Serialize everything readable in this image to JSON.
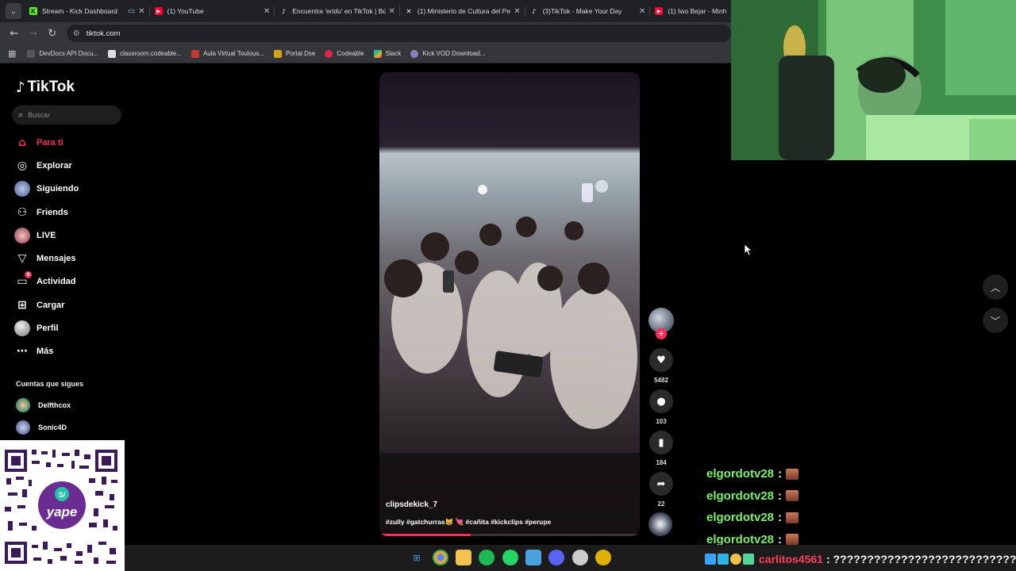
{
  "browser": {
    "tabs": [
      {
        "label": "Stream - Kick Dashboard",
        "icon": "kick-icon",
        "color": "#53fc18"
      },
      {
        "label": "(1) YouTube",
        "icon": "youtube-icon",
        "color": "#ff0033"
      },
      {
        "label": "Encuentra 'eridu' en TikTok | Bú",
        "icon": "tiktok-icon",
        "color": "#ffffff"
      },
      {
        "label": "(1) Ministerio de Cultura del Pe",
        "icon": "x-icon",
        "color": "#ffffff"
      },
      {
        "label": "(3)TikTok - Make Your Day",
        "icon": "tiktok-icon",
        "color": "#ffffff"
      },
      {
        "label": "(1) Iwo Bejar - Minha E",
        "icon": "youtube-icon",
        "color": "#ff0033"
      }
    ],
    "url": "tiktok.com",
    "bookmarks": [
      {
        "label": "DevDocs API Docu...",
        "color": "#555555"
      },
      {
        "label": "classroom.codeable...",
        "color": "#dddddd"
      },
      {
        "label": "Aula Virtual Toulous...",
        "color": "#c0392b"
      },
      {
        "label": "Portal Dse",
        "color": "#d4a017"
      },
      {
        "label": "Codeable",
        "color": "#e0264b"
      },
      {
        "label": "Slack",
        "color": "#e01e5a"
      },
      {
        "label": "Kick VOD Download...",
        "color": "#8e7cc3"
      }
    ]
  },
  "tiktok": {
    "logo": "TikTok",
    "search_placeholder": "Buscar",
    "nav": [
      {
        "label": "Para ti",
        "icon": "home-icon",
        "active": true
      },
      {
        "label": "Explorar",
        "icon": "compass-icon"
      },
      {
        "label": "Siguiendo",
        "icon": "following-avatar-icon"
      },
      {
        "label": "Friends",
        "icon": "friends-icon"
      },
      {
        "label": "LIVE",
        "icon": "live-icon"
      },
      {
        "label": "Mensajes",
        "icon": "messages-icon"
      },
      {
        "label": "Actividad",
        "icon": "activity-icon",
        "badge": "5"
      },
      {
        "label": "Cargar",
        "icon": "upload-icon"
      },
      {
        "label": "Perfil",
        "icon": "profile-avatar-icon"
      },
      {
        "label": "Más",
        "icon": "more-icon"
      }
    ],
    "following_title": "Cuentas que sigues",
    "following": [
      {
        "name": "Delfthcox"
      },
      {
        "name": "Sonic4D"
      }
    ],
    "video": {
      "author": "clipsdekick_7",
      "caption": "#zully #gatchurras😸 💘 #cañita #kickclips #perupe",
      "progress": 0.35
    },
    "actions": {
      "likes": "5482",
      "comments": "103",
      "saves": "184",
      "shares": "22"
    }
  },
  "chat": {
    "lines": [
      {
        "user": "elgordotv28",
        "sep": ":"
      },
      {
        "user": "elgordotv28",
        "sep": ":"
      },
      {
        "user": "elgordotv28",
        "sep": ":"
      },
      {
        "user": "elgordotv28",
        "sep": ":"
      }
    ],
    "bottom": {
      "user": "carlitos4561",
      "message": ": ????????????????????????????"
    }
  },
  "taskbar": {
    "apps": [
      {
        "icon": "windows-start-icon",
        "color": "#3aa0ff"
      },
      {
        "icon": "chrome-icon",
        "color": "#e8a33c"
      },
      {
        "icon": "file-explorer-icon",
        "color": "#f2c14e"
      },
      {
        "icon": "spotify-icon",
        "color": "#1db954"
      },
      {
        "icon": "whatsapp-icon",
        "color": "#25d366"
      },
      {
        "icon": "photos-icon",
        "color": "#4aa3df"
      },
      {
        "icon": "discord-icon",
        "color": "#5865f2"
      },
      {
        "icon": "obs-icon",
        "color": "#cccccc"
      },
      {
        "icon": "app-icon",
        "color": "#e0b000"
      }
    ]
  }
}
